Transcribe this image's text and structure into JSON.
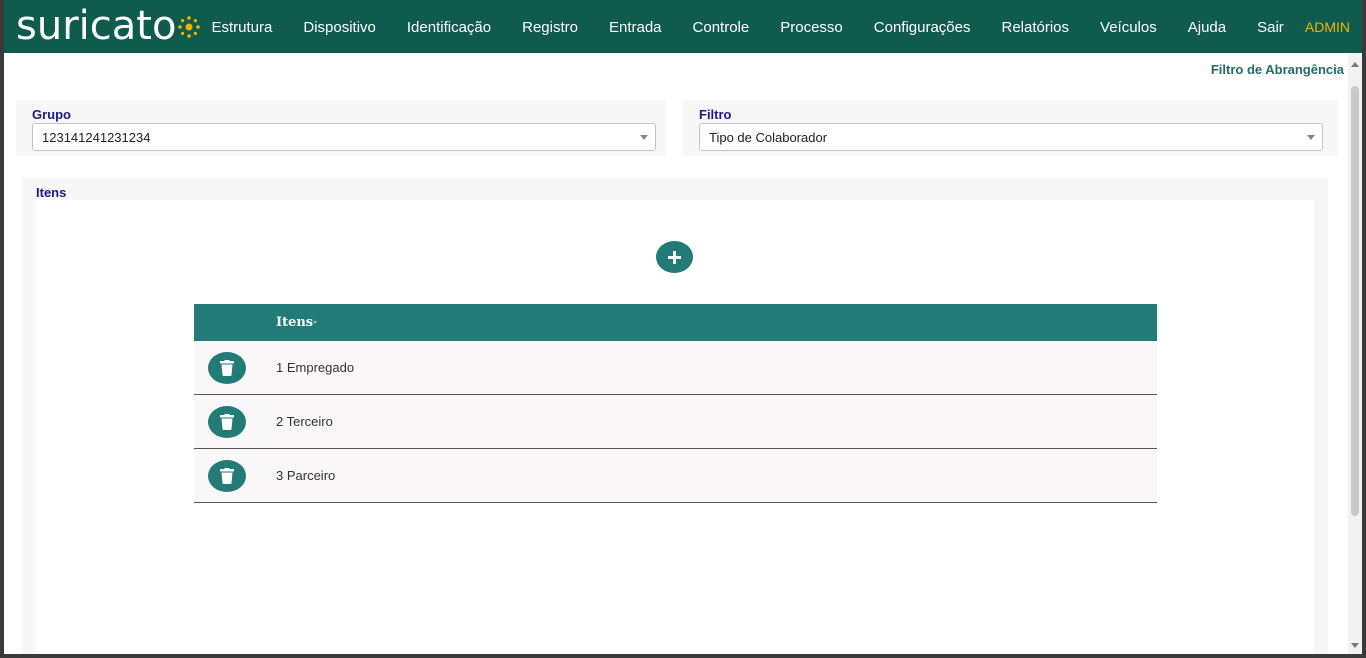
{
  "brand": {
    "logo_text": "suricato"
  },
  "nav": {
    "items": [
      {
        "label": "Estrutura"
      },
      {
        "label": "Dispositivo"
      },
      {
        "label": "Identificação"
      },
      {
        "label": "Registro"
      },
      {
        "label": "Entrada"
      },
      {
        "label": "Controle"
      },
      {
        "label": "Processo"
      },
      {
        "label": "Configurações"
      },
      {
        "label": "Relatórios"
      },
      {
        "label": "Veículos"
      },
      {
        "label": "Ajuda"
      },
      {
        "label": "Sair"
      }
    ],
    "user": "ADMIN"
  },
  "page": {
    "filter_link": "Filtro de Abrangência",
    "grupo": {
      "label": "Grupo",
      "value": "123141241231234"
    },
    "filtro": {
      "label": "Filtro",
      "value": "Tipo de Colaborador"
    },
    "itens_section": {
      "label": "Itens"
    }
  },
  "table": {
    "header": "Itens",
    "rows": [
      {
        "text": "1 Empregado"
      },
      {
        "text": "2 Terceiro"
      },
      {
        "text": "3 Parceiro"
      }
    ]
  },
  "icons": {
    "add": "plus-icon",
    "delete": "trash-icon",
    "dropdown": "chevron-down-icon",
    "sort": "sort-caret-icon"
  },
  "colors": {
    "navbar": "#0f5c4f",
    "accent": "#227b76",
    "admin": "#f0b400",
    "label": "#1a1a8c",
    "link": "#1f6c68"
  }
}
